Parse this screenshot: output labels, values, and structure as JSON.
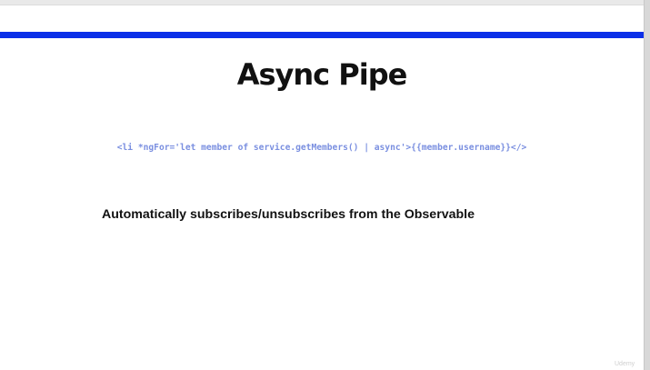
{
  "slide": {
    "title": "Async Pipe",
    "code": "<li *ngFor='let member of service.getMembers() | async'>{{member.username}}</>",
    "bullet": "Automatically subscribes/unsubscribes from the Observable",
    "watermark": "Udemy"
  },
  "colors": {
    "accent_bar": "#0a2fe8",
    "code_text": "#7a8fe0",
    "title_text": "#111111"
  }
}
